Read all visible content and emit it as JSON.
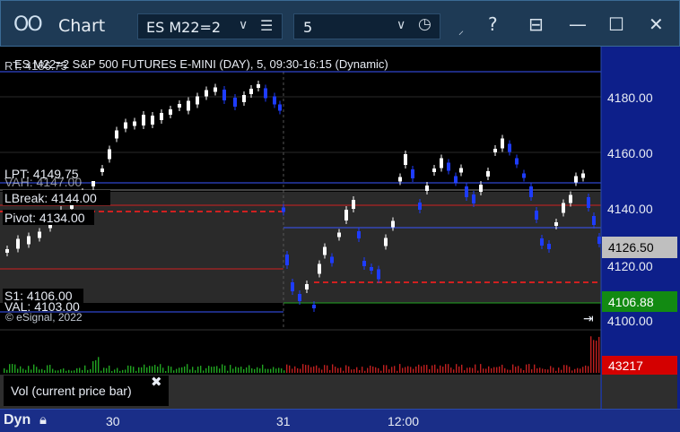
{
  "titlebar": {
    "icon": "OO",
    "title": "Chart",
    "symbol": "ES M22=2",
    "interval": "5",
    "buttons": {
      "dropdown_arrow": "∨",
      "menu": "☰",
      "clock": "◷",
      "help": "?",
      "template": "⊟",
      "minimize": "—",
      "maximize": "☐",
      "close": "✕"
    }
  },
  "chart_header": {
    "description": "ES M22=2 S&P 500 FUTURES E-MINI (DAY), 5, 09:30-16:15 (Dynamic)",
    "rt_label": "RT: 4186.75",
    "copyright": "© eSignal, 2022"
  },
  "price_axis": {
    "ticks": [
      "4180.00",
      "4160.00",
      "4140.00",
      "4120.00",
      "4100.00"
    ],
    "current_price": "4126.50",
    "green_tag": "4106.88",
    "volume_tag": "43217"
  },
  "levels": {
    "lpt": "LPT: 4149.75",
    "vah": "VAH: 4147.00",
    "lbreak": "LBreak: 4144.00",
    "pivot": "Pivot: 4134.00",
    "s1": "S1: 4106.00",
    "val": "VAL: 4103.00"
  },
  "study": {
    "label": "Vol (current price bar)",
    "close": "✖"
  },
  "x_axis": {
    "dyn": "Dyn",
    "labels": [
      "30",
      "31",
      "12:00"
    ]
  },
  "colors": {
    "bull": "#ffffff",
    "bear": "#1e3cff",
    "magenta": "#e020e0",
    "green_count": "#21a521",
    "pivot_red": "#d02020",
    "value_line": "#3a56ff",
    "price_axis_bg": "#0d1f8a"
  }
}
